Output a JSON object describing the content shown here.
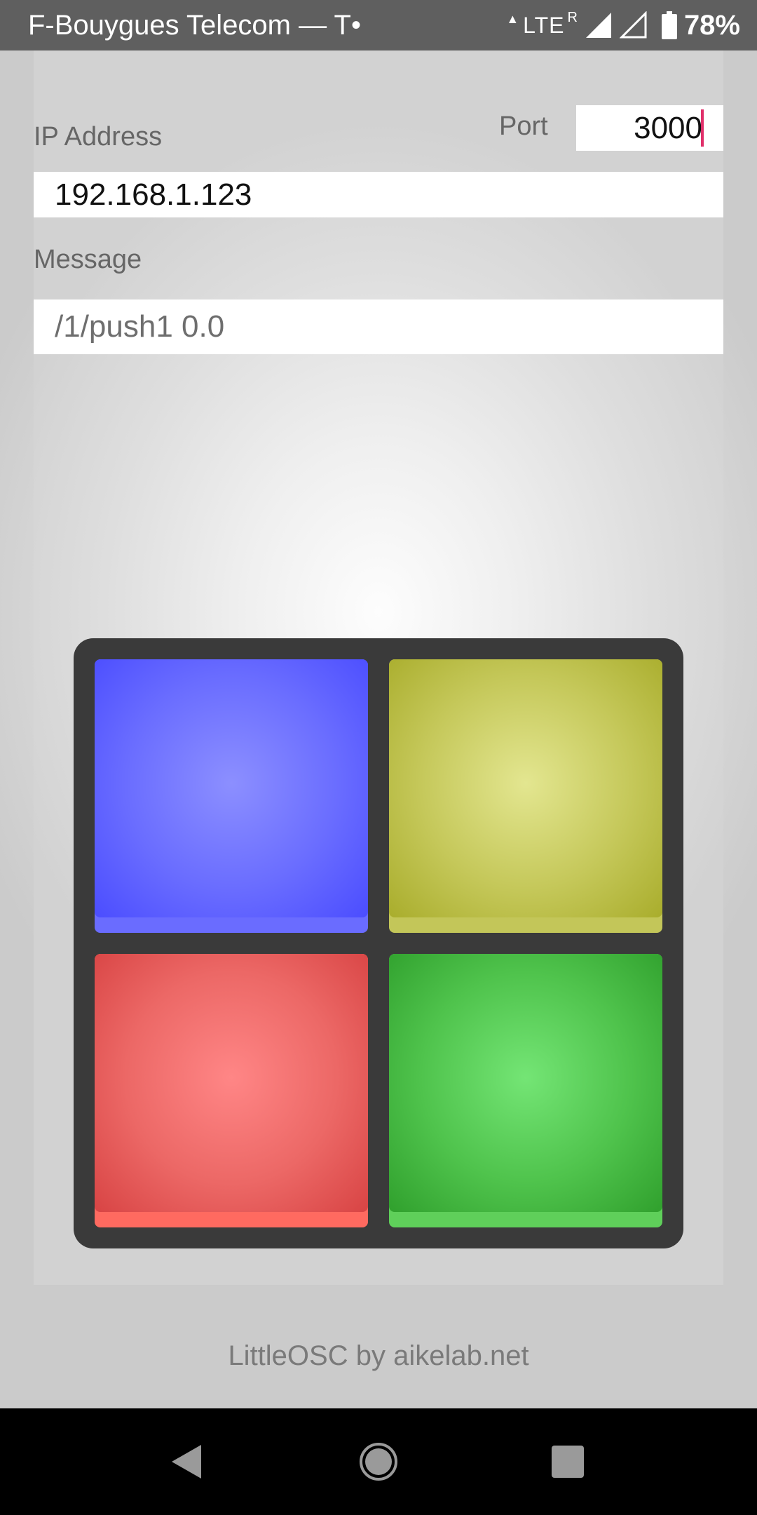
{
  "status_bar": {
    "carrier": "F-Bouygues Telecom — T•",
    "network": "LTE",
    "roaming": "R",
    "battery": "78%"
  },
  "form": {
    "ip_label": "IP Address",
    "ip_value": "192.168.1.123",
    "port_label": "Port",
    "port_value": "3000",
    "message_label": "Message",
    "message_value": "/1/push1 0.0"
  },
  "pads": [
    {
      "id": "push1",
      "color": "#6a6dff"
    },
    {
      "id": "push2",
      "color": "#c5c85a"
    },
    {
      "id": "push3",
      "color": "#ec6866"
    },
    {
      "id": "push4",
      "color": "#4fc34c"
    }
  ],
  "footer": {
    "text": "LittleOSC by aikelab.net"
  },
  "nav_bar": {
    "back_icon": "back-icon",
    "home_icon": "home-icon",
    "recents_icon": "recents-icon"
  }
}
